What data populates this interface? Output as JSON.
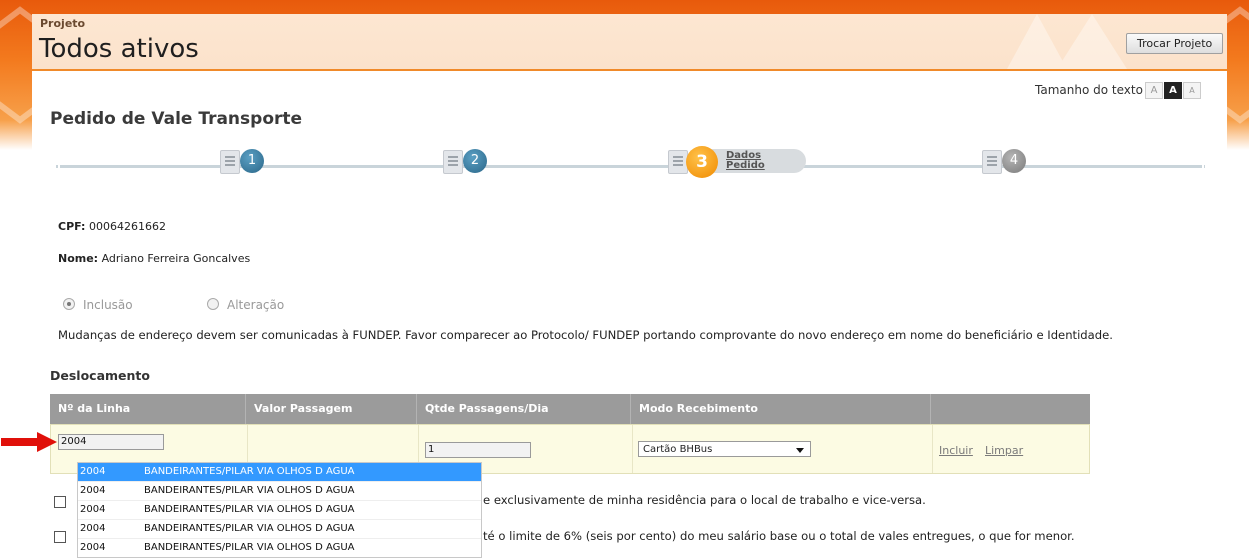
{
  "header": {
    "label": "Projeto",
    "title": "Todos ativos",
    "switch_button": "Trocar Projeto"
  },
  "text_size": {
    "label": "Tamanho do texto",
    "buttons": [
      "A",
      "A",
      "A"
    ]
  },
  "page_title": "Pedido de Vale Transporte",
  "wizard": {
    "steps": [
      "1",
      "2",
      "3",
      "4"
    ],
    "active_step": "3",
    "active_label_line1": "Dados",
    "active_label_line2": "Pedido"
  },
  "person": {
    "cpf_label": "CPF:",
    "cpf": "00064261662",
    "name_label": "Nome:",
    "name": "Adriano Ferreira Goncalves"
  },
  "request_type": {
    "options": [
      "Inclusão",
      "Alteração"
    ],
    "selected": "Inclusão"
  },
  "notice": "Mudanças de endereço devem ser comunicadas à FUNDEP. Favor comparecer ao Protocolo/ FUNDEP portando comprovante do novo endereço em nome do beneficiário e Identidade.",
  "displacement": {
    "title": "Deslocamento",
    "columns": [
      "Nº da Linha",
      "Valor Passagem",
      "Qtde Passagens/Dia",
      "Modo Recebimento"
    ],
    "line_number": "2004",
    "fare_value": "",
    "trips_per_day": "1",
    "receive_mode": "Cartão BHBus",
    "include_link": "Incluir",
    "clear_link": "Limpar"
  },
  "autocomplete": [
    {
      "code": "2004",
      "name": "BANDEIRANTES/PILAR VIA OLHOS D AGUA"
    },
    {
      "code": "2004",
      "name": "BANDEIRANTES/PILAR VIA OLHOS D AGUA"
    },
    {
      "code": "2004",
      "name": "BANDEIRANTES/PILAR VIA OLHOS D AGUA"
    },
    {
      "code": "2004",
      "name": "BANDEIRANTES/PILAR VIA OLHOS D AGUA"
    },
    {
      "code": "2004",
      "name": "BANDEIRANTES/PILAR VIA OLHOS D AGUA"
    }
  ],
  "declarations": [
    {
      "checked": false,
      "text": "e exclusivamente de minha residência para o local de trabalho e vice-versa."
    },
    {
      "checked": false,
      "text": "té o limite de 6% (seis por cento) do meu salário base ou o total de vales entregues, o que for menor."
    }
  ],
  "colors": {
    "header_orange": "#f37a1e",
    "table_header": "#9b9b9b",
    "row_bg": "#fcfbe3",
    "step_blue": "#2a6688",
    "step_orange": "#f08a00",
    "selection": "#3399ff",
    "arrow_red": "#e0100a"
  }
}
